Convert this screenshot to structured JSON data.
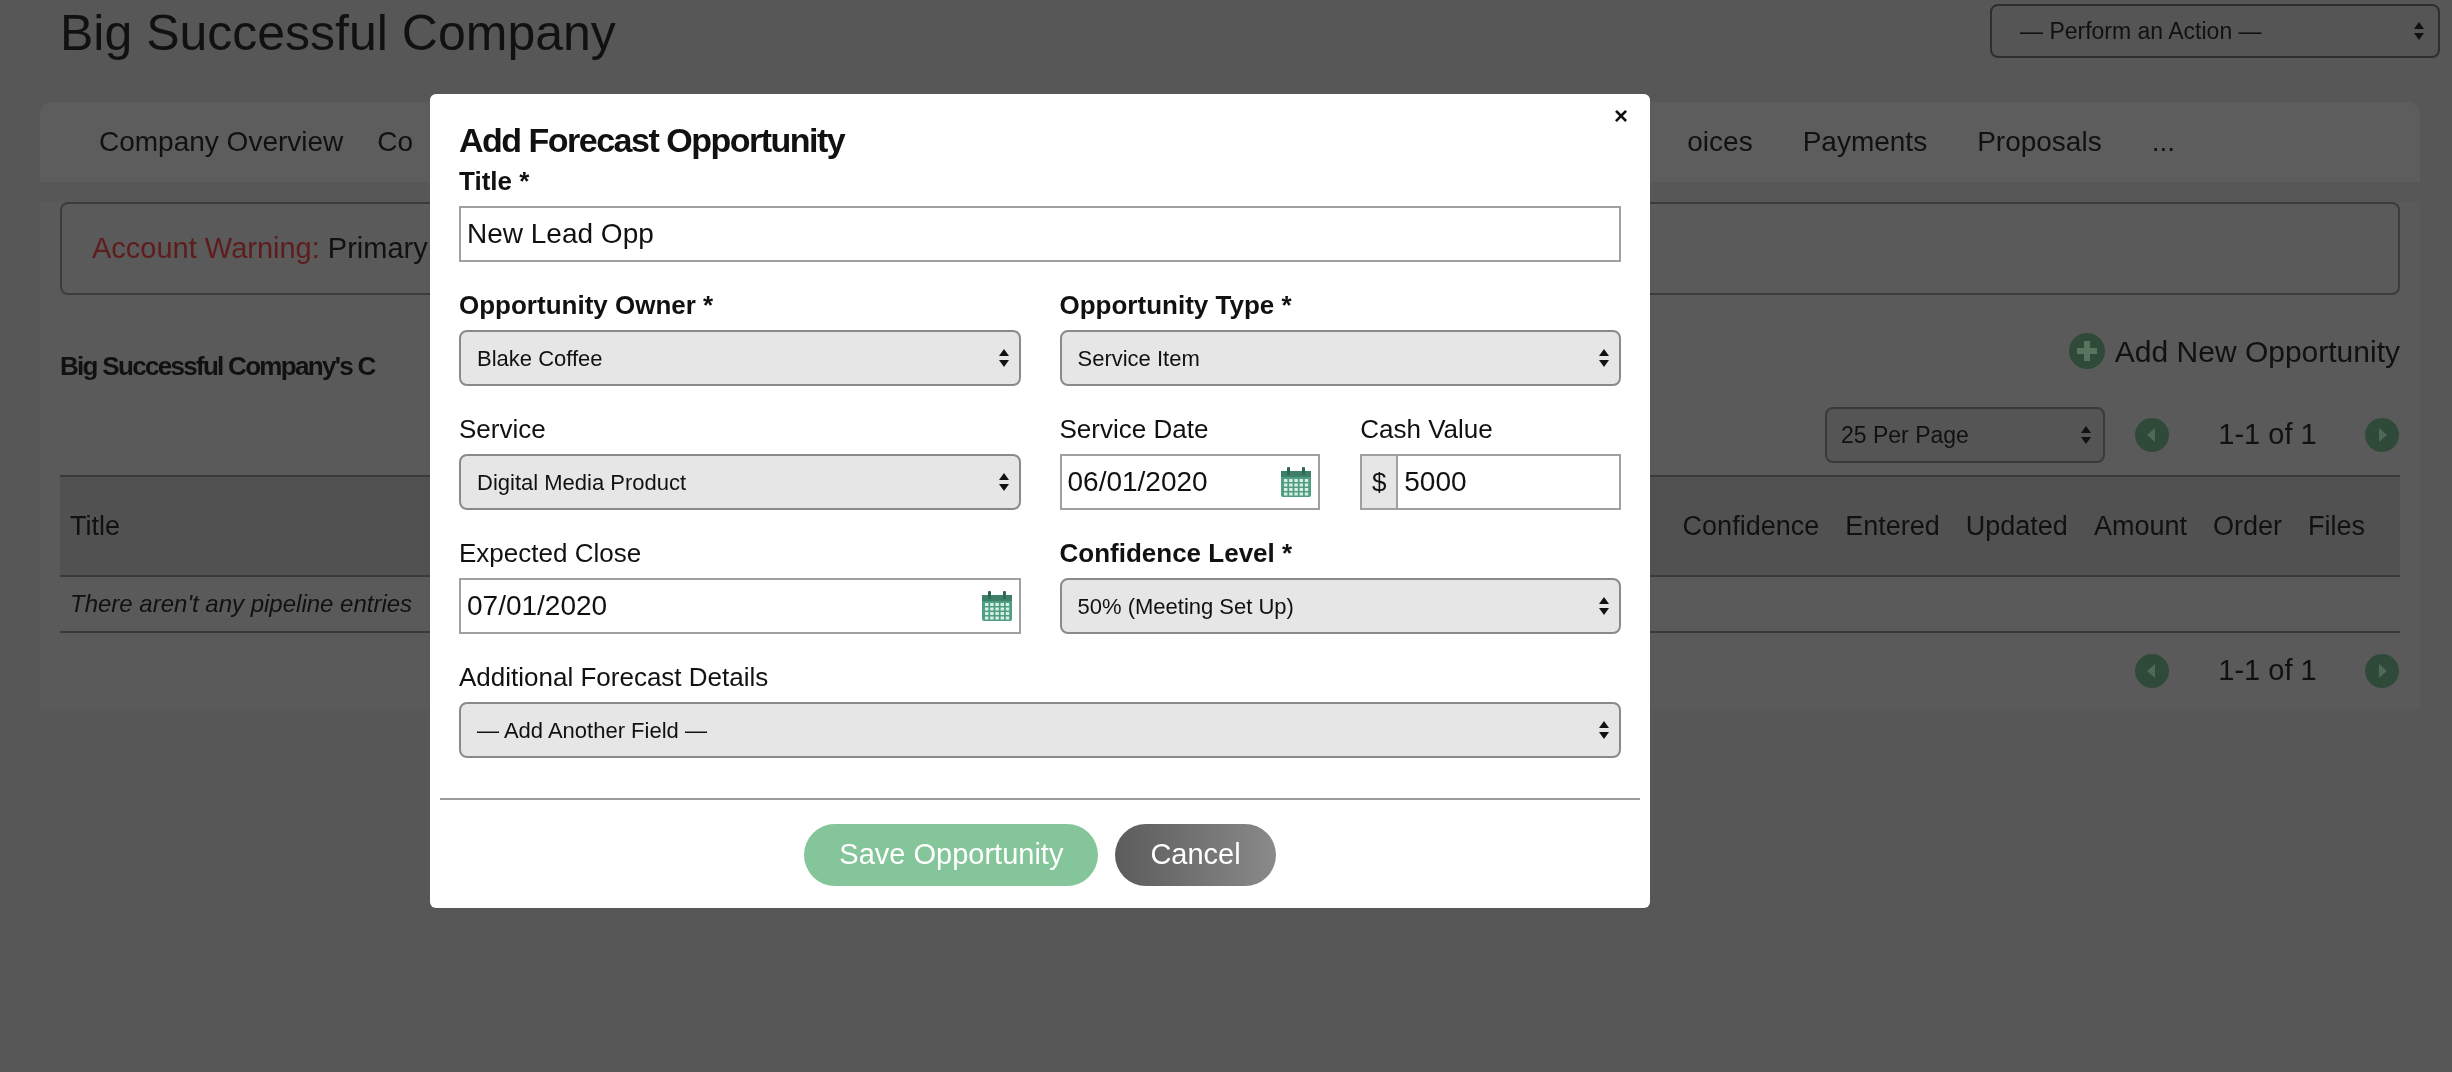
{
  "page_title": "Big Successful Company",
  "action_select": {
    "value": "— Perform an Action —"
  },
  "tabs_left": [
    "Company Overview",
    "Co"
  ],
  "tabs_right": [
    "oices",
    "Payments",
    "Proposals",
    "..."
  ],
  "warning": {
    "label": "Account Warning:",
    "text": "Primary"
  },
  "section_title": "Big Successful Company's C",
  "add_link": "Add New Opportunity",
  "pagination_top": {
    "per_page": "25 Per Page",
    "range": "1-1 of 1"
  },
  "table": {
    "columns_left": [
      "Title"
    ],
    "columns_right": [
      "Confidence",
      "Entered",
      "Updated",
      "Amount",
      "Order",
      "Files"
    ],
    "empty_message": "There aren't any pipeline entries"
  },
  "pagination_bottom": {
    "range": "1-1 of 1"
  },
  "modal": {
    "title": "Add Forecast Opportunity",
    "close": "×",
    "rows": [
      {
        "fields": [
          {
            "label": "Title *",
            "required": true,
            "kind": "text",
            "value": "New Lead Opp"
          }
        ]
      },
      {
        "fields": [
          {
            "label": "Opportunity Owner *",
            "required": true,
            "kind": "select",
            "value": "Blake Coffee"
          },
          {
            "label": "Opportunity Type *",
            "required": true,
            "kind": "select",
            "value": "Service Item"
          }
        ]
      },
      {
        "fields": [
          {
            "label": "Service",
            "required": false,
            "kind": "select",
            "value": "Digital Media Product"
          },
          {
            "label": "Service Date",
            "required": false,
            "kind": "date",
            "value": "06/01/2020"
          },
          {
            "label": "Cash Value",
            "required": false,
            "kind": "currency",
            "prefix": "$",
            "value": "5000"
          }
        ]
      },
      {
        "fields": [
          {
            "label": "Expected Close",
            "required": false,
            "kind": "date",
            "value": "07/01/2020"
          },
          {
            "label": "Confidence Level *",
            "required": true,
            "kind": "select",
            "value": "50% (Meeting Set Up)"
          }
        ]
      },
      {
        "fields": [
          {
            "label": "Additional Forecast Details",
            "required": false,
            "kind": "select",
            "value": "— Add Another Field —"
          }
        ]
      }
    ],
    "buttons": [
      {
        "label": "Save Opportunity",
        "kind": "primary"
      },
      {
        "label": "Cancel",
        "kind": "secondary"
      }
    ]
  }
}
